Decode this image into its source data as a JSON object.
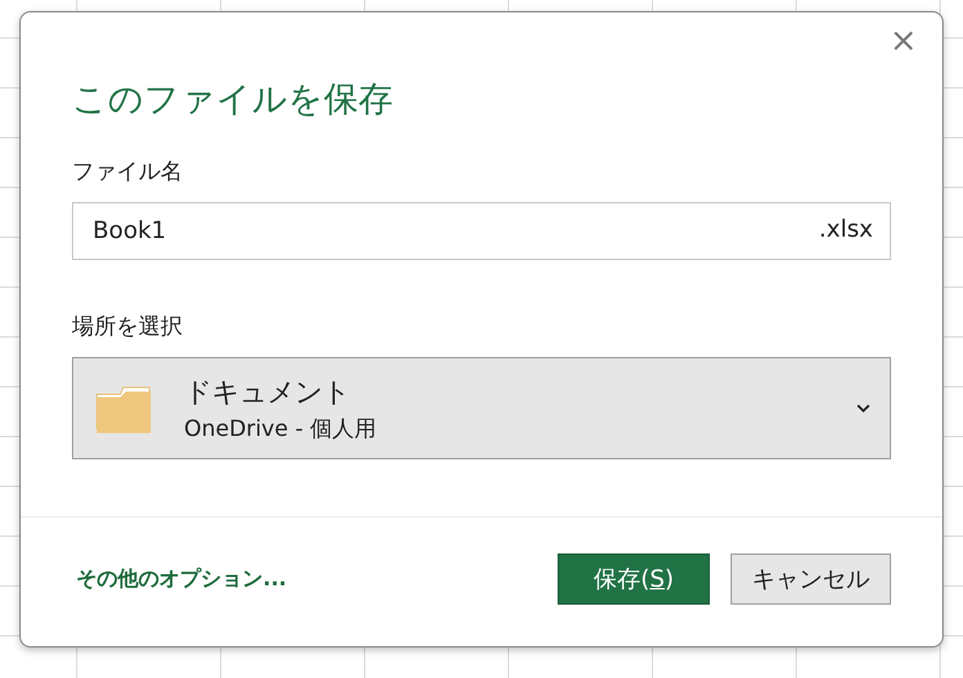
{
  "dialog": {
    "title": "このファイルを保存",
    "close": "×"
  },
  "file_name": {
    "label": "ファイル名",
    "value": "Book1",
    "extension": ".xlsx"
  },
  "location": {
    "label": "場所を選択",
    "name": "ドキュメント",
    "detail": "OneDrive - 個人用"
  },
  "more_options": "その他のオプション...",
  "buttons": [
    {
      "kind": "primary",
      "before": "保存(",
      "access_key": "S",
      "after": ")"
    },
    {
      "kind": "secondary",
      "before": "キャンセル"
    }
  ]
}
